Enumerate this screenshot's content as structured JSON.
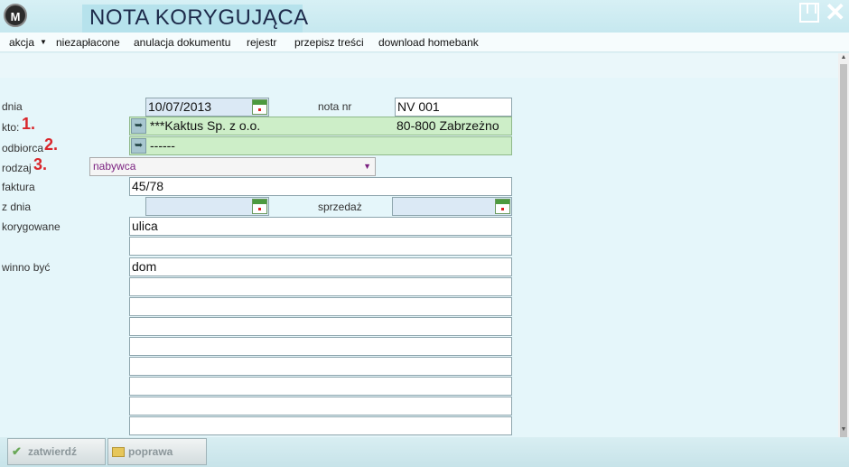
{
  "window": {
    "logo_text": "M",
    "title": "NOTA KORYGUJĄCA",
    "restore_icon": "restore-window-icon",
    "close_icon": "close-icon",
    "close_glyph": "✕"
  },
  "menu": {
    "items": [
      "akcja",
      "niezapłacone",
      "anulacja dokumentu",
      "rejestr",
      "przepisz treści",
      "download homebank"
    ],
    "akcja_arrow": "▼"
  },
  "form": {
    "dnia_label": "dnia",
    "dnia_value": "10/07/2013",
    "nota_nr_label": "nota nr",
    "nota_nr_value": "NV 001",
    "kto_label": "kto:",
    "kto_marker": "1.",
    "kto_value": "***Kaktus Sp. z o.o.",
    "kto_city": "80-800 Zabrzeżno",
    "odbiorca_label": "odbiorca",
    "odbiorca_marker": "2.",
    "odbiorca_value": "------",
    "rodzaj_label": "rodzaj",
    "rodzaj_marker": "3.",
    "rodzaj_value": "nabywca",
    "rodzaj_arrow": "▼",
    "faktura_label": "faktura",
    "faktura_value": "45/78",
    "z_dnia_label": "z dnia",
    "z_dnia_value": "",
    "sprzedaz_label": "sprzedaż",
    "sprzedaz_value": "",
    "korygowane_label": "korygowane",
    "korygowane_lines": [
      "ulica",
      ""
    ],
    "winno_byc_label": "winno być",
    "winno_byc_lines": [
      "dom",
      "",
      "",
      "",
      "",
      "",
      "",
      "",
      ""
    ]
  },
  "buttons": {
    "zatwierdz": "zatwierdź",
    "poprawa": "poprawa"
  },
  "colors": {
    "accent_red": "#d9262b",
    "title_text": "#1d2a4a",
    "green_field": "#cdeec8",
    "date_field": "#dbe9f5"
  }
}
